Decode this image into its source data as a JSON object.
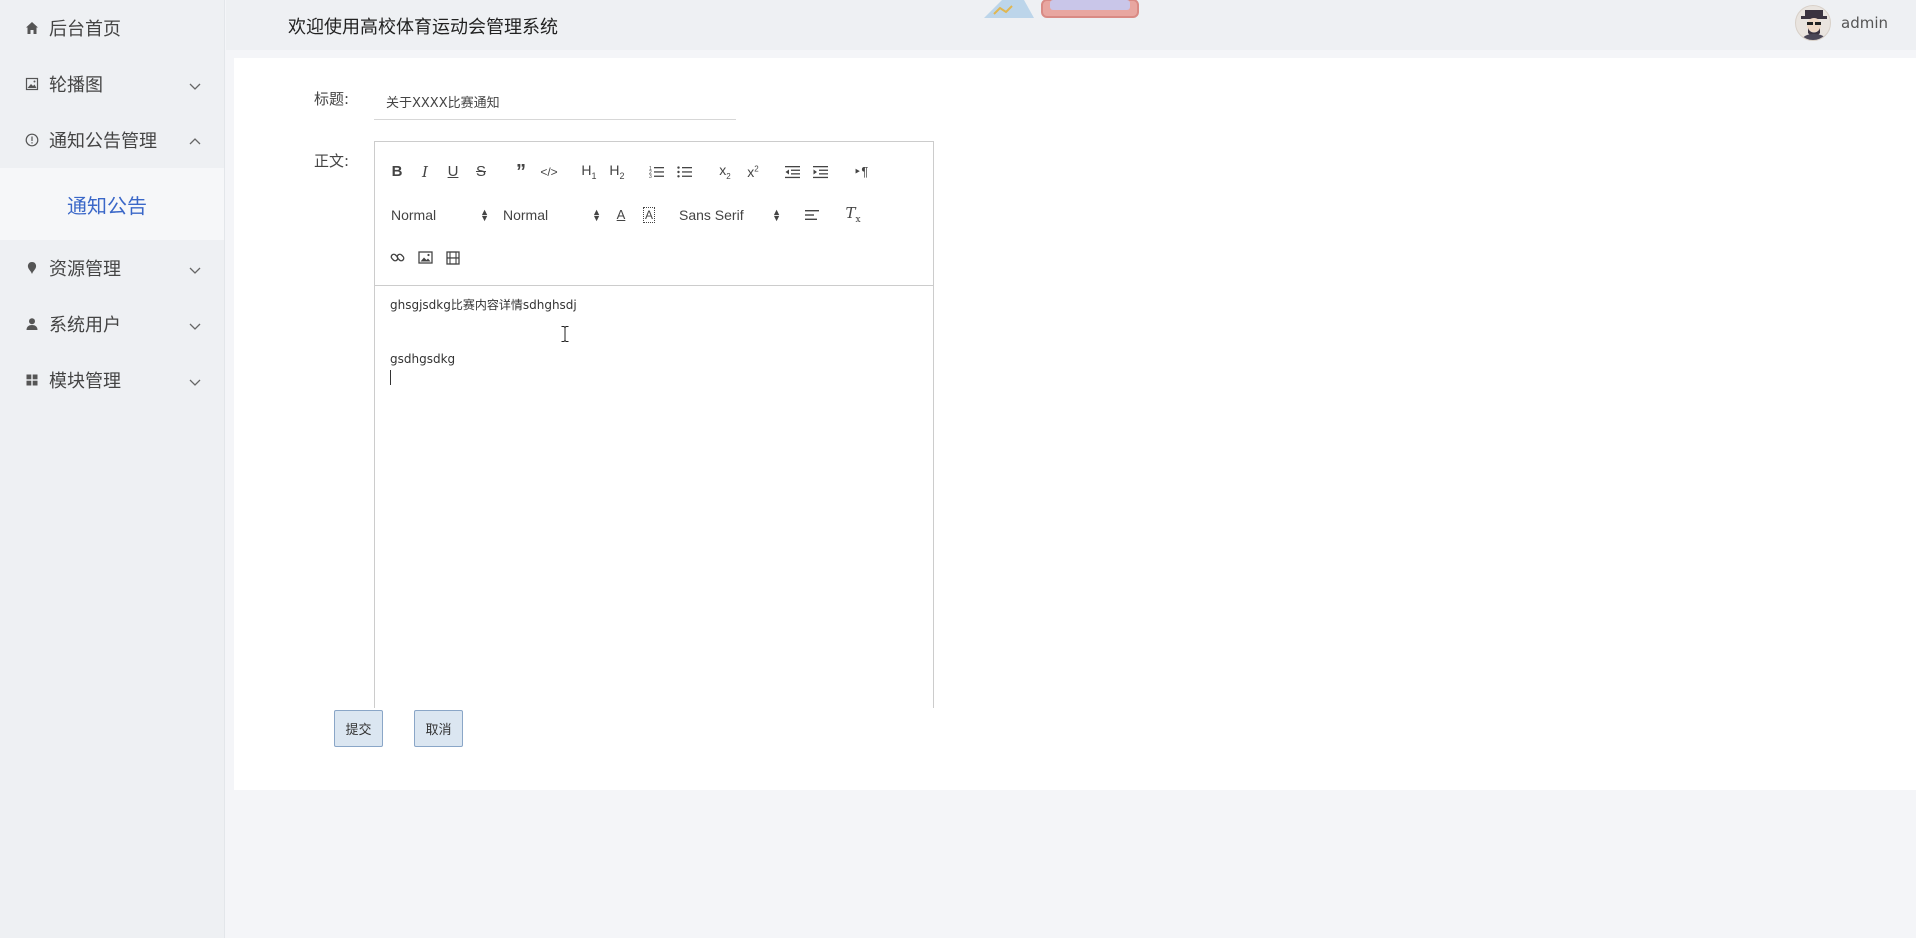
{
  "header": {
    "title": "欢迎使用高校体育运动会管理系统",
    "user_name": "admin"
  },
  "sidebar": {
    "items": [
      {
        "label": "后台首页",
        "icon": "home-icon"
      },
      {
        "label": "轮播图",
        "icon": "image-icon"
      },
      {
        "label": "通知公告管理",
        "icon": "info-circle-icon",
        "expanded": true
      },
      {
        "label": "资源管理",
        "icon": "pin-icon"
      },
      {
        "label": "系统用户",
        "icon": "user-icon"
      },
      {
        "label": "模块管理",
        "icon": "grid-icon"
      }
    ],
    "sub_items": [
      {
        "label": "通知公告",
        "active": true
      }
    ]
  },
  "form": {
    "title_label": "标题:",
    "title_value": "关于XXXX比赛通知",
    "body_label": "正文:",
    "editor": {
      "toolbar": {
        "header_select": "Normal",
        "size_select": "Normal",
        "font_select": "Sans Serif"
      },
      "lines": [
        "ghsgjsdkg比赛内容详情sdhghsdj",
        "",
        "gsdhgsdkg"
      ]
    },
    "submit_label": "提交",
    "cancel_label": "取消"
  },
  "colors": {
    "accent": "#3a67c8",
    "sidebar_bg": "#eef0f3",
    "button_bg": "#dbe6f1",
    "button_border": "#8aa6c7"
  }
}
